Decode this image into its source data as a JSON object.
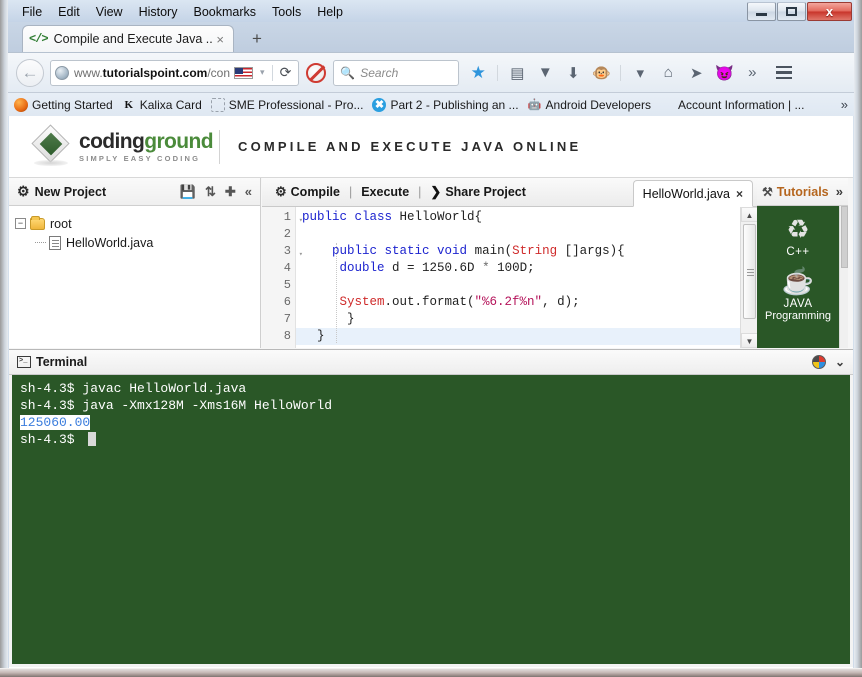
{
  "window": {
    "minimize_label": "Minimize",
    "maximize_label": "Maximize",
    "close_label": "x"
  },
  "menubar": {
    "items": [
      {
        "label": "File"
      },
      {
        "label": "Edit"
      },
      {
        "label": "View"
      },
      {
        "label": "History"
      },
      {
        "label": "Bookmarks"
      },
      {
        "label": "Tools"
      },
      {
        "label": "Help"
      }
    ]
  },
  "tabs": {
    "active": {
      "title": "Compile and Execute Java ...",
      "close": "×",
      "icon": "</>"
    },
    "new_tab": "+"
  },
  "navbar": {
    "back": "←",
    "url_prefix": "www.",
    "url_domain": "tutorialspoint.com",
    "url_path": "/con",
    "flag": "us-flag-icon",
    "dropdown": "▾",
    "reload": "⟳",
    "noscript": "noscript-icon",
    "search_placeholder": "Search",
    "search_value": "",
    "icons": [
      {
        "name": "bookmark-star-icon",
        "glyph": "★"
      },
      {
        "name": "reading-list-icon",
        "glyph": "▤"
      },
      {
        "name": "pocket-icon",
        "glyph": "⬇"
      },
      {
        "name": "downloads-icon",
        "glyph": "⬇"
      },
      {
        "name": "monkey-avatar-icon",
        "glyph": "🐵"
      },
      {
        "name": "chevron-down-icon",
        "glyph": "▾"
      },
      {
        "name": "home-icon",
        "glyph": "⌂"
      },
      {
        "name": "send-icon",
        "glyph": "➤"
      },
      {
        "name": "shield-icon",
        "glyph": "●"
      },
      {
        "name": "overflow-icon",
        "glyph": "»"
      }
    ]
  },
  "bookmarks": {
    "items": [
      {
        "label": "Getting Started",
        "icon": "firefox-icon"
      },
      {
        "label": "Kalixa Card",
        "icon": "kalixa-icon"
      },
      {
        "label": "SME Professional - Pro...",
        "icon": "placeholder-icon"
      },
      {
        "label": "Part 2 - Publishing an ...",
        "icon": "x-circle-icon"
      },
      {
        "label": "Android Developers",
        "icon": "android-icon"
      },
      {
        "label": "Account Information | ...",
        "icon": "microsoft-icon"
      }
    ],
    "overflow": "»"
  },
  "site": {
    "logo_main_part1": "coding",
    "logo_main_part2": "ground",
    "logo_sub": "SIMPLY EASY CODING",
    "page_title": "COMPILE AND EXECUTE JAVA ONLINE"
  },
  "project_panel": {
    "title": "New Project",
    "actions": [
      {
        "name": "save-icon",
        "glyph": "💾"
      },
      {
        "name": "refresh-icon",
        "glyph": "↻"
      },
      {
        "name": "add-icon",
        "glyph": "＋"
      },
      {
        "name": "collapse-icon",
        "glyph": "«"
      }
    ],
    "tree": {
      "root_label": "root",
      "root_toggle": "−",
      "children": [
        {
          "label": "HelloWorld.java"
        }
      ]
    }
  },
  "editor": {
    "toolbar": {
      "compile": "Compile",
      "execute": "Execute",
      "share": "Share Project",
      "separator": "|"
    },
    "file_tab": {
      "label": "HelloWorld.java",
      "close": "×"
    },
    "active_line": 8,
    "lines": [
      {
        "num": 1,
        "fold": true,
        "tokens": [
          {
            "t": "public ",
            "c": "k"
          },
          {
            "t": "class ",
            "c": "k"
          },
          {
            "t": "HelloWorld{",
            "c": "p"
          }
        ]
      },
      {
        "num": 2,
        "fold": false,
        "tokens": []
      },
      {
        "num": 3,
        "fold": true,
        "tokens": [
          {
            "t": "    ",
            "c": "p"
          },
          {
            "t": "public ",
            "c": "k"
          },
          {
            "t": "static ",
            "c": "k"
          },
          {
            "t": "void ",
            "c": "k"
          },
          {
            "t": "main(",
            "c": "p"
          },
          {
            "t": "String",
            "c": "t"
          },
          {
            "t": " []args){",
            "c": "p"
          }
        ]
      },
      {
        "num": 4,
        "fold": false,
        "tokens": [
          {
            "t": "     ",
            "c": "p"
          },
          {
            "t": "double",
            "c": "k"
          },
          {
            "t": " d = ",
            "c": "p"
          },
          {
            "t": "1250.6D",
            "c": "n"
          },
          {
            "t": " * ",
            "c": "op"
          },
          {
            "t": "100D",
            "c": "n"
          },
          {
            "t": ";",
            "c": "p"
          }
        ]
      },
      {
        "num": 5,
        "fold": false,
        "tokens": []
      },
      {
        "num": 6,
        "fold": false,
        "tokens": [
          {
            "t": "     ",
            "c": "p"
          },
          {
            "t": "System",
            "c": "t"
          },
          {
            "t": ".out.format(",
            "c": "p"
          },
          {
            "t": "\"%6.2f%n\"",
            "c": "s"
          },
          {
            "t": ", d);",
            "c": "p"
          }
        ]
      },
      {
        "num": 7,
        "fold": false,
        "tokens": [
          {
            "t": "      }",
            "c": "p"
          }
        ]
      },
      {
        "num": 8,
        "fold": false,
        "tokens": [
          {
            "t": "  }",
            "c": "p"
          }
        ]
      }
    ],
    "scrollbar": {
      "up": "▲",
      "down": "▼"
    }
  },
  "tutorials_panel": {
    "title": "Tutorials",
    "expand": "»",
    "items": [
      {
        "label": "C++",
        "label2": "",
        "glyph": "♻"
      },
      {
        "label": "JAVA",
        "label2": "Programming",
        "glyph": "☕"
      }
    ]
  },
  "terminal": {
    "title": "Terminal",
    "lines": [
      {
        "text": "sh-4.3$ javac HelloWorld.java",
        "selected": false
      },
      {
        "text": "sh-4.3$ java -Xmx128M -Xms16M HelloWorld",
        "selected": false
      },
      {
        "text": "125060.00",
        "selected": true
      },
      {
        "text": "sh-4.3$ ",
        "selected": false,
        "cursor": true
      }
    ]
  },
  "colors": {
    "terminal_bg": "#2a5727",
    "selection_bg": "#ffffff",
    "selection_fg": "#3b7ddd",
    "accent_green": "#4b8b3b",
    "tutorials_title": "#b5651d"
  }
}
